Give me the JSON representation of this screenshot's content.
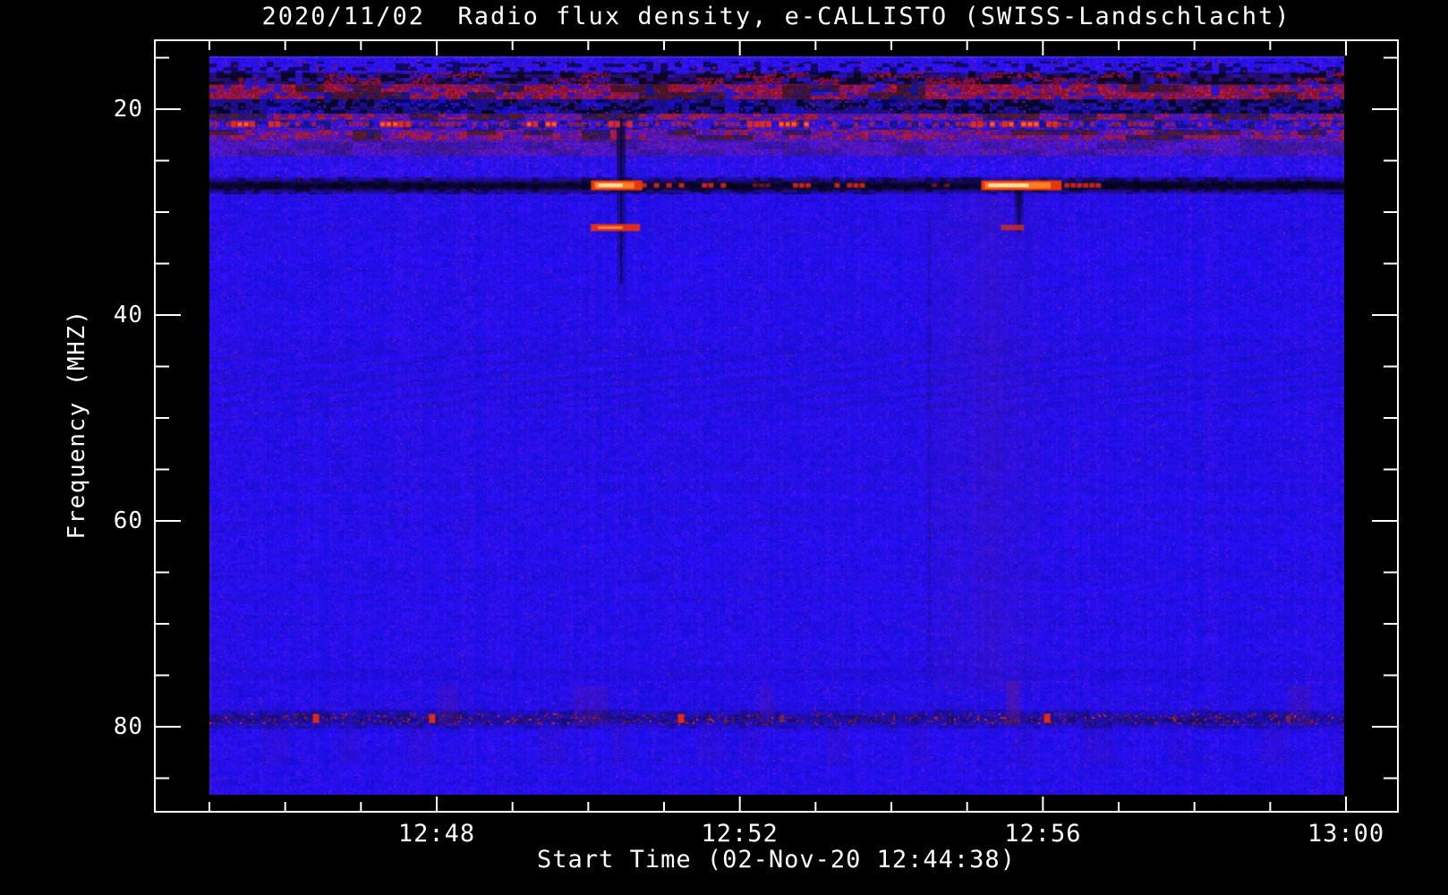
{
  "page": {
    "background": "#000000",
    "text_color": "#FFFFFF"
  },
  "chart_data": {
    "type": "heatmap",
    "subtype": "radio-spectrogram",
    "title": "2020/11/02  Radio flux density, e-CALLISTO (SWISS-Landschlacht)",
    "xlabel": "Start Time (02-Nov-20 12:44:38)",
    "ylabel": "Frequency (MHZ)",
    "legend": "none",
    "grid": "off",
    "x_axis": {
      "start_time": "12:44:38",
      "end_time": "13:00:00",
      "data_start": "12:45:00",
      "data_end": "13:00:00",
      "major_ticks": [
        "12:48",
        "12:52",
        "12:56",
        "13:00"
      ],
      "major_tick_minutes": [
        48,
        52,
        56,
        60
      ],
      "minor_tick_interval_min": 1
    },
    "y_axis": {
      "unit": "MHz",
      "top_mhz": 14.8,
      "bottom_mhz": 86.7,
      "major_ticks": [
        20,
        40,
        60,
        80
      ],
      "minor_tick_interval": 5,
      "orientation": "frequency increases downward"
    },
    "colormap": {
      "background_blue": "#2B14E8",
      "noise_dark": "#140A50",
      "noise_red": "#8C1432",
      "burst_red": "#F43C0A",
      "burst_core": "#FFE1AA",
      "rfi_dark_line": "#070522"
    },
    "texture_bands": [
      {
        "f0": 14.8,
        "f1": 15.35,
        "style": "blue"
      },
      {
        "f0": 15.35,
        "f1": 16.35,
        "style": "blue_streaky"
      },
      {
        "f0": 16.35,
        "f1": 17.55,
        "style": "dark_mottled"
      },
      {
        "f0": 17.55,
        "f1": 19.0,
        "style": "red_mottled"
      },
      {
        "f0": 19.0,
        "f1": 20.35,
        "style": "navy_dashes"
      },
      {
        "f0": 20.35,
        "f1": 21.0,
        "style": "red_blue_mix"
      },
      {
        "f0": 21.0,
        "f1": 22.0,
        "style": "bright_red_row"
      },
      {
        "f0": 22.0,
        "f1": 22.9,
        "style": "red_blue_mix"
      },
      {
        "f0": 22.9,
        "f1": 24.5,
        "style": "purple_haze"
      },
      {
        "f0": 24.5,
        "f1": 26.55,
        "style": "blue"
      },
      {
        "f0": 26.55,
        "f1": 28.25,
        "style": "dark_line"
      },
      {
        "f0": 28.25,
        "f1": 43.5,
        "style": "blue_calm"
      },
      {
        "f0": 43.5,
        "f1": 49.2,
        "style": "wavy"
      },
      {
        "f0": 49.2,
        "f1": 78.3,
        "style": "blue_calm"
      },
      {
        "f0": 78.3,
        "f1": 80.1,
        "style": "dark_channel"
      },
      {
        "f0": 80.1,
        "f1": 86.7,
        "style": "blue_calm"
      }
    ],
    "features": {
      "rfi_absorption_line": {
        "freq_mhz": 27.4,
        "t0": "12:45:00",
        "t1": "13:00:00"
      },
      "bursts_27mhz": [
        {
          "t0": "12:50:05",
          "t1": "12:50:40",
          "strength": "strong"
        },
        {
          "t0": "12:50:42",
          "t1": "12:51:25",
          "strength": "medium"
        },
        {
          "t0": "12:51:30",
          "t1": "12:51:48",
          "strength": "medium"
        },
        {
          "t0": "12:52:10",
          "t1": "12:52:33",
          "strength": "faint"
        },
        {
          "t0": "12:52:42",
          "t1": "12:52:54",
          "strength": "medium"
        },
        {
          "t0": "12:53:15",
          "t1": "12:53:40",
          "strength": "medium"
        },
        {
          "t0": "12:54:32",
          "t1": "12:54:46",
          "strength": "faint"
        },
        {
          "t0": "12:55:14",
          "t1": "12:56:12",
          "strength": "strong"
        },
        {
          "t0": "12:56:12",
          "t1": "12:56:50",
          "strength": "medium"
        }
      ],
      "dark_dashes_27mhz": [
        {
          "t0": "12:57:07",
          "t1": "12:57:57"
        },
        {
          "t0": "12:58:20",
          "t1": "12:59:55"
        }
      ],
      "bursts_31mhz": [
        {
          "t0": "12:50:02",
          "t1": "12:50:41",
          "strength": "strong"
        },
        {
          "t0": "12:55:27",
          "t1": "12:55:45",
          "strength": "medium"
        }
      ],
      "red_dash_row": {
        "freq_mhz": 21.5,
        "bright_segments": [
          [
            "12:45:17",
            "12:45:55"
          ],
          [
            "12:47:15",
            "12:47:41"
          ],
          [
            "12:49:11",
            "12:49:35"
          ],
          [
            "12:50:16",
            "12:50:34"
          ],
          [
            "12:52:06",
            "12:52:52"
          ],
          [
            "12:55:03",
            "12:56:10"
          ]
        ]
      },
      "dark_channel_79mhz": {
        "freq_mhz": 79.2,
        "red_dots": [
          "12:46:24",
          "12:47:56",
          "12:51:13",
          "12:56:03"
        ],
        "faint_dots": [
          "12:52:33",
          "12:59:14"
        ]
      },
      "red_smudges_77mhz": [
        {
          "t0": "12:48:01",
          "t1": "12:48:17",
          "strength": "faint"
        },
        {
          "t0": "12:49:48",
          "t1": "12:50:16",
          "strength": "faint"
        },
        {
          "t0": "12:52:16",
          "t1": "12:52:27",
          "strength": "faint"
        },
        {
          "t0": "12:55:31",
          "t1": "12:55:42",
          "strength": "strong"
        },
        {
          "t0": "12:59:14",
          "t1": "12:59:32",
          "strength": "faint"
        }
      ],
      "vertical_streaks": [
        {
          "t": "12:50:26",
          "f0": 21.0,
          "f1": 41.0,
          "kind": "dark"
        },
        {
          "t": "12:54:30",
          "f0": 30.0,
          "f1": 75.0,
          "kind": "faint-dark"
        },
        {
          "t": "12:55:41",
          "f0": 27.8,
          "f1": 33.0,
          "kind": "dark"
        }
      ],
      "haze_column": {
        "t0": "12:54:33",
        "t1": "12:55:58",
        "f0": 28.5,
        "f1": 76.5
      }
    }
  }
}
